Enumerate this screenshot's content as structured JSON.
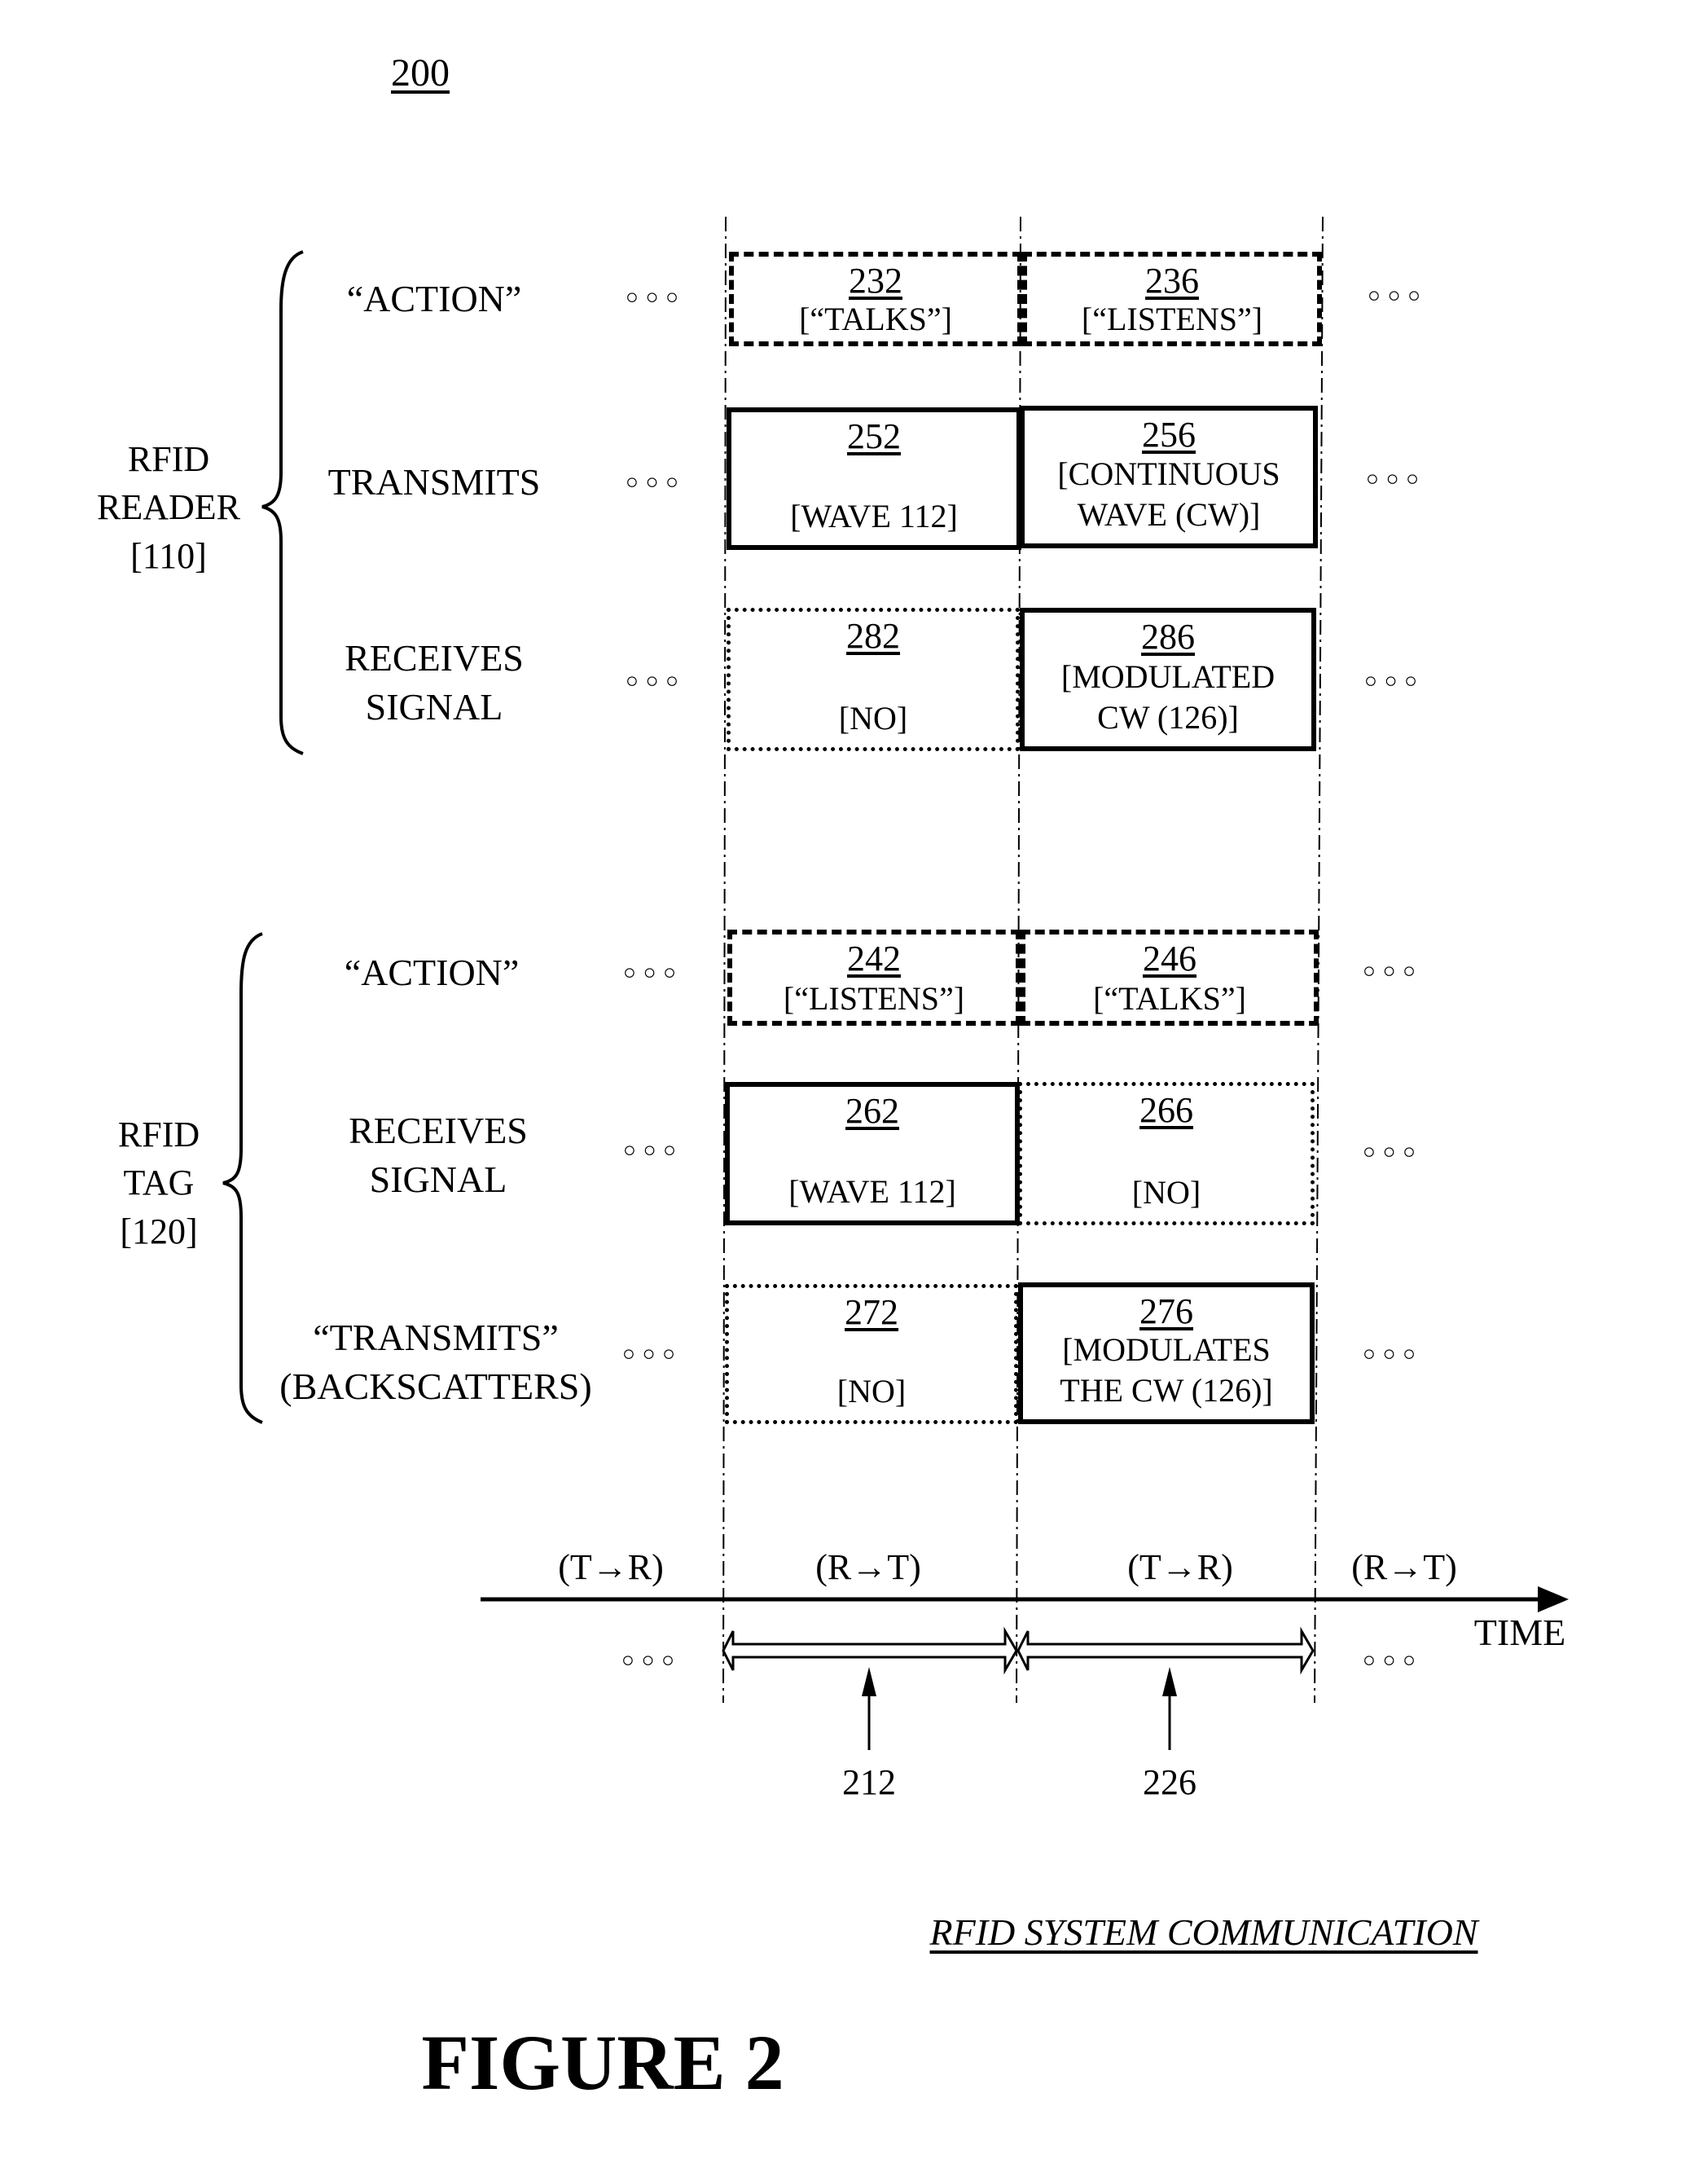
{
  "figure_number": "200",
  "reader": {
    "group_label": "RFID\nREADER\n[110]",
    "rows": [
      {
        "label": "“ACTION”",
        "ellipsis_left": "◦◦◦",
        "ellipsis_right": "◦◦◦",
        "cells": [
          {
            "ref": "232",
            "desc": "[“TALKS”]",
            "style": "dashed"
          },
          {
            "ref": "236",
            "desc": "[“LISTENS”]",
            "style": "dashed"
          }
        ]
      },
      {
        "label": "TRANSMITS",
        "ellipsis_left": "◦◦◦",
        "ellipsis_right": "◦◦◦",
        "cells": [
          {
            "ref": "252",
            "desc": "[WAVE 112]",
            "style": "solid"
          },
          {
            "ref": "256",
            "desc": "[CONTINUOUS\nWAVE (CW)]",
            "style": "solid"
          }
        ]
      },
      {
        "label": "RECEIVES\nSIGNAL",
        "ellipsis_left": "◦◦◦",
        "ellipsis_right": "◦◦◦",
        "cells": [
          {
            "ref": "282",
            "desc": "[NO]",
            "style": "dotted"
          },
          {
            "ref": "286",
            "desc": "[MODULATED\nCW (126)]",
            "style": "solid"
          }
        ]
      }
    ]
  },
  "tag": {
    "group_label": "RFID\nTAG\n[120]",
    "rows": [
      {
        "label": "“ACTION”",
        "ellipsis_left": "◦◦◦",
        "ellipsis_right": "◦◦◦",
        "cells": [
          {
            "ref": "242",
            "desc": "[“LISTENS”]",
            "style": "dashed"
          },
          {
            "ref": "246",
            "desc": "[“TALKS”]",
            "style": "dashed"
          }
        ]
      },
      {
        "label": "RECEIVES\nSIGNAL",
        "ellipsis_left": "◦◦◦",
        "ellipsis_right": "◦◦◦",
        "cells": [
          {
            "ref": "262",
            "desc": "[WAVE 112]",
            "style": "solid"
          },
          {
            "ref": "266",
            "desc": "[NO]",
            "style": "dotted"
          }
        ]
      },
      {
        "label": "“TRANSMITS”\n(BACKSCATTERS)",
        "ellipsis_left": "◦◦◦",
        "ellipsis_right": "◦◦◦",
        "cells": [
          {
            "ref": "272",
            "desc": "[NO]",
            "style": "dotted"
          },
          {
            "ref": "276",
            "desc": "[MODULATES\nTHE CW (126)]",
            "style": "solid"
          }
        ]
      }
    ]
  },
  "timeline": {
    "phases": [
      "(T→R)",
      "(R→T)",
      "(T→R)",
      "(R→T)"
    ],
    "axis_label": "TIME",
    "ellipsis_left": "◦◦◦",
    "ellipsis_right": "◦◦◦",
    "callouts": [
      "212",
      "226"
    ]
  },
  "caption": "RFID SYSTEM COMMUNICATION",
  "figure_title": "FIGURE 2"
}
